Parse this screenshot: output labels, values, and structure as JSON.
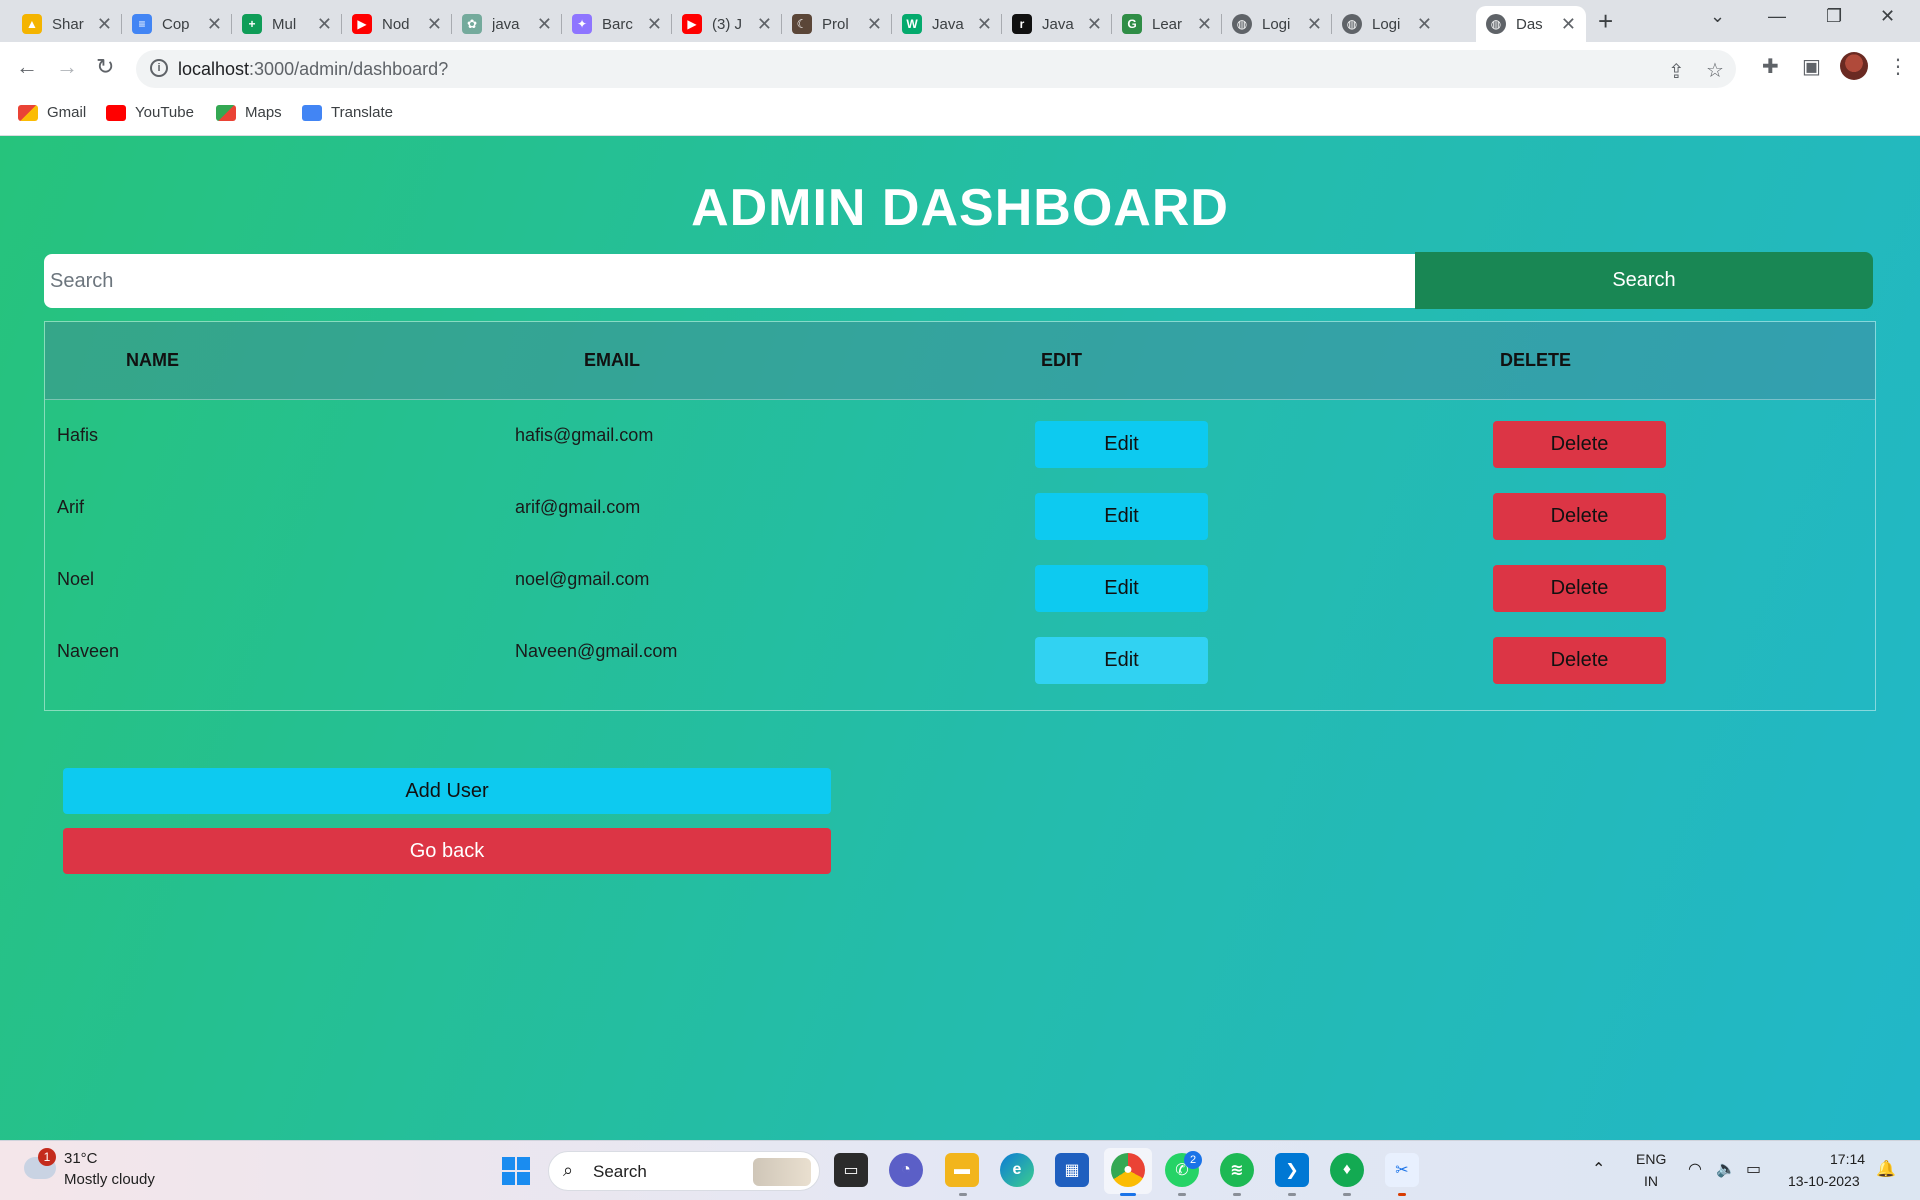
{
  "browser": {
    "tabs": [
      {
        "title": "Shar",
        "icon": "google-drive-icon",
        "color": "#f4b400"
      },
      {
        "title": "Cop",
        "icon": "google-docs-icon",
        "color": "#4285f4"
      },
      {
        "title": "Mul",
        "icon": "google-sheets-icon",
        "color": "#0f9d58"
      },
      {
        "title": "Nod",
        "icon": "youtube-icon",
        "color": "#ff0000"
      },
      {
        "title": "java",
        "icon": "chatgpt-icon",
        "color": "#74aa9c"
      },
      {
        "title": "Barc",
        "icon": "bard-icon",
        "color": "#8e75ff"
      },
      {
        "title": "(3) J",
        "icon": "youtube-icon",
        "color": "#ff0000"
      },
      {
        "title": "Prol",
        "icon": "codechef-icon",
        "color": "#5b4638"
      },
      {
        "title": "Java",
        "icon": "w3schools-icon",
        "color": "#04aa6d"
      },
      {
        "title": "Java",
        "icon": "generic-site-icon",
        "color": "#111111"
      },
      {
        "title": "Lear",
        "icon": "geeksforgeeks-icon",
        "color": "#2f8d46"
      },
      {
        "title": "Logi",
        "icon": "globe-icon",
        "color": "#5f6368"
      },
      {
        "title": "Logi",
        "icon": "globe-icon",
        "color": "#5f6368"
      },
      {
        "title": "Das",
        "icon": "globe-icon",
        "color": "#5f6368",
        "active": true
      }
    ],
    "url_host": "localhost",
    "url_path": ":3000/admin/dashboard?",
    "bookmarks": [
      {
        "label": "Gmail",
        "icon": "gmail-icon"
      },
      {
        "label": "YouTube",
        "icon": "youtube-icon"
      },
      {
        "label": "Maps",
        "icon": "google-maps-icon"
      },
      {
        "label": "Translate",
        "icon": "google-translate-icon"
      }
    ]
  },
  "page": {
    "title": "ADMIN DASHBOARD",
    "search": {
      "placeholder": "Search",
      "button": "Search"
    },
    "table": {
      "headers": [
        "NAME",
        "EMAIL",
        "EDIT",
        "DELETE"
      ],
      "rows": [
        {
          "name": "Hafis",
          "email": "hafis@gmail.com",
          "edit": "Edit",
          "delete": "Delete"
        },
        {
          "name": "Arif",
          "email": "arif@gmail.com",
          "edit": "Edit",
          "delete": "Delete"
        },
        {
          "name": "Noel",
          "email": "noel@gmail.com",
          "edit": "Edit",
          "delete": "Delete"
        },
        {
          "name": "Naveen",
          "email": "Naveen@gmail.com",
          "edit": "Edit",
          "delete": "Delete"
        }
      ]
    },
    "add_user": "Add User",
    "go_back": "Go back",
    "colors": {
      "edit": "#0dcaf0",
      "delete": "#dc3545",
      "search": "#198754"
    }
  },
  "taskbar": {
    "weather_temp": "31°C",
    "weather_desc": "Mostly cloudy",
    "weather_badge": "1",
    "search_label": "Search",
    "whatsapp_badge": "2",
    "lang_1": "ENG",
    "lang_2": "IN",
    "time": "17:14",
    "date": "13-10-2023"
  }
}
